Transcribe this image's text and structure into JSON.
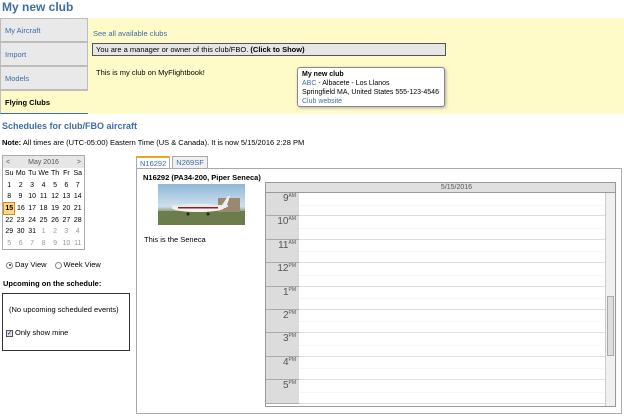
{
  "page_title": "My new club",
  "nav": {
    "items": [
      {
        "label": "My Aircraft"
      },
      {
        "label": "Import"
      },
      {
        "label": "Models"
      },
      {
        "label": "Flying Clubs"
      }
    ]
  },
  "club": {
    "see_all_link": "See all available clubs",
    "manager_bar_text": "You are a manager or owner of this club/FBO.",
    "manager_bar_action": "(Click to Show)",
    "description": "This is my club on MyFlightbook!",
    "info": {
      "name": "My new club",
      "airport_code": "ABC",
      "airport_rest": " - Albacete - Los Llanos",
      "address": "Springfield MA, United States 555-123-4546",
      "website_link": "Club website"
    }
  },
  "schedule": {
    "title": "Schedules for club/FBO aircraft",
    "note_label": "Note:",
    "note_text": " All times are (UTC-05:00) Eastern Time (US & Canada). It is now 5/15/2016 2:28 PM",
    "calendar": {
      "prev": "<",
      "next": ">",
      "month": "May 2016",
      "weekdays": [
        "Su",
        "Mo",
        "Tu",
        "We",
        "Th",
        "Fr",
        "Sa"
      ],
      "weeks": [
        [
          "1",
          "2",
          "3",
          "4",
          "5",
          "6",
          "7"
        ],
        [
          "8",
          "9",
          "10",
          "11",
          "12",
          "13",
          "14"
        ],
        [
          "15",
          "16",
          "17",
          "18",
          "19",
          "20",
          "21"
        ],
        [
          "22",
          "23",
          "24",
          "25",
          "26",
          "27",
          "28"
        ],
        [
          "29",
          "30",
          "31",
          "1",
          "2",
          "3",
          "4"
        ],
        [
          "5",
          "6",
          "7",
          "8",
          "9",
          "10",
          "11"
        ]
      ],
      "selected": "15"
    },
    "view_day": "Day View",
    "view_week": "Week View",
    "upcoming_title": "Upcoming on the schedule:",
    "upcoming_empty": "(No upcoming scheduled events)",
    "only_mine": "Only show mine",
    "tabs": [
      "N16292",
      "N269SF"
    ],
    "aircraft_name": "N16292 (PA34-200, Piper Seneca)",
    "aircraft_desc": "This is the Seneca",
    "day_header": "5/15/2016",
    "hours": [
      {
        "h": "9",
        "ap": "AM"
      },
      {
        "h": "10",
        "ap": "AM"
      },
      {
        "h": "11",
        "ap": "AM"
      },
      {
        "h": "12",
        "ap": "PM"
      },
      {
        "h": "1",
        "ap": "PM"
      },
      {
        "h": "2",
        "ap": "PM"
      },
      {
        "h": "3",
        "ap": "PM"
      },
      {
        "h": "4",
        "ap": "PM"
      },
      {
        "h": "5",
        "ap": "PM"
      }
    ]
  }
}
